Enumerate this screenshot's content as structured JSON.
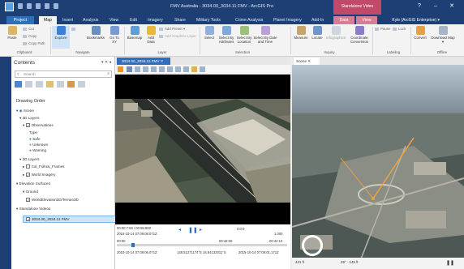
{
  "window": {
    "title": "FMV Australia - 3034.00_3034.11 FMV - ArcGIS Pro",
    "context_tab_group": "Standalone Video",
    "help": "?",
    "minimize": "–",
    "maximize": "☐",
    "close": "✕"
  },
  "tabs": [
    "Project",
    "Map",
    "Insert",
    "Analysis",
    "View",
    "Edit",
    "Imagery",
    "Share",
    "Military Tools",
    "Crime Analysis",
    "Planet Imagery",
    "Add-In",
    "Data",
    "View"
  ],
  "user": "Kyle (ArcGIS Enterprise) ▾",
  "ribbon": {
    "clipboard": {
      "paste": "Paste",
      "cut": "Cut",
      "copy": "Copy",
      "copy_path": "Copy Path",
      "group": "Clipboard"
    },
    "navigate": {
      "explore": "Explore",
      "bookmarks": "Bookmarks",
      "goto": "Go To XY",
      "group": "Navigate"
    },
    "layer": {
      "basemap": "Basemap",
      "add_data": "Add Data",
      "add_preset": "Add Preset ▾",
      "add_graphics": "Add Graphics Layer",
      "group": "Layer"
    },
    "selection": {
      "select": "Select",
      "by_attr": "Select By Attributes",
      "by_loc": "Select By Location",
      "by_date": "Select By Date and Time",
      "group": "Selection"
    },
    "inquiry": {
      "measure": "Measure",
      "locate": "Locate",
      "infographics": "Infographics",
      "coord": "Coordinate Conversion",
      "group": "Inquiry"
    },
    "labeling": {
      "pause": "Pause",
      "lock": "Lock",
      "group": "Labeling"
    },
    "offline": {
      "convert": "Convert",
      "download": "Download Map ▾",
      "group": "Offline"
    }
  },
  "contents": {
    "title": "Contents",
    "controls": "▾ ✕ ◂",
    "search_placeholder": "Search",
    "drawing_order": "Drawing Order",
    "scene": "Scene",
    "layers_3d": "3D Layers",
    "observations": "Observations",
    "type": "Type",
    "safe": "Safe",
    "unknown": "Unknown",
    "warning": "Warning",
    "layers_2d": "2D Layers",
    "cal_frames": "Cal_Follow_Frames",
    "world_imagery": "World Imagery",
    "elevation": "Elevation Surfaces",
    "ground": "Ground",
    "world_elev": "WorldElevation3D/Terrain3D",
    "standalone": "Standalone Videos",
    "video_item": "3034.00_3034.11 FMV"
  },
  "video_view": {
    "tab": "3034.00_3034.11 FMV ✕",
    "time_elapsed": "00:00:7:59 / 00:55:800",
    "date_top": "2015-10-14 07:09:08.071Z",
    "speed_rate": "1.000",
    "scale": "0:0:0",
    "date_bottom_left": "2015-10-14 07:09:06.071Z",
    "coords": "148.51371174°E 34.84132011°S",
    "date_bottom_right": "2015-10-14 07:09:01.171Z",
    "t1": "00:00",
    "t2": "00:42:00",
    "t3": "00:42:10",
    "pause": "❚❚"
  },
  "scene_view": {
    "tab": "Scene ✕",
    "scale": "431 ft",
    "status": "29° · 145 ft"
  },
  "colors": {
    "titlebar": "#1e3f73",
    "accent": "#2e6ebd",
    "context_tab": "#c14a6a"
  }
}
